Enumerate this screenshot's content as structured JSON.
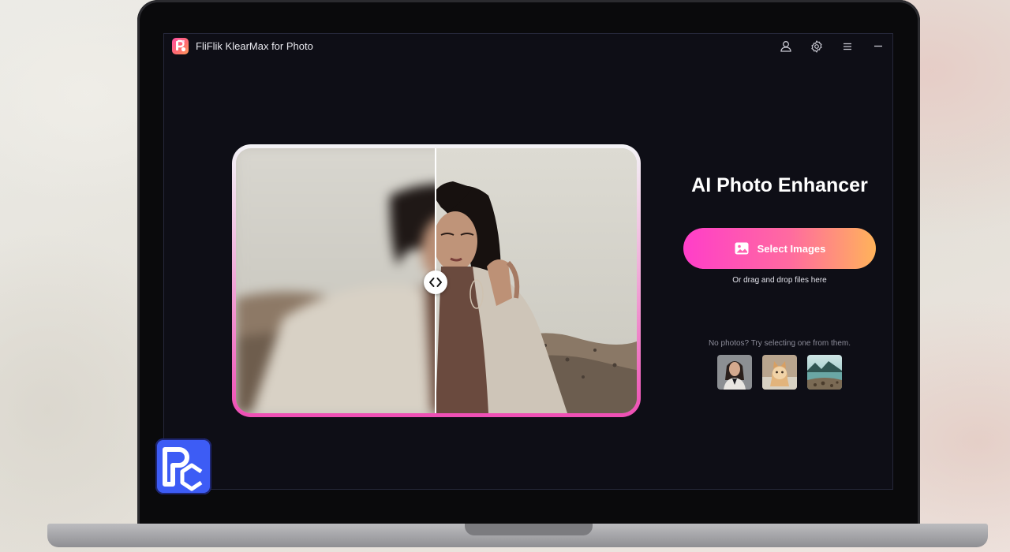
{
  "app": {
    "title": "FliFlik KlearMax for Photo",
    "logo_icon": "app-logo-icon"
  },
  "titlebar": {
    "icons": [
      "user-icon",
      "settings-icon",
      "menu-icon",
      "minimize-icon"
    ]
  },
  "comparison": {
    "left_state": "blurred original",
    "right_state": "enhanced",
    "handle_icon": "chevron-left-right-icon"
  },
  "main": {
    "headline": "AI Photo Enhancer",
    "select_button_label": "Select Images",
    "select_button_icon": "image-icon",
    "drag_hint": "Or drag and drop files here",
    "samples_hint": "No photos? Try selecting one from them.",
    "samples": [
      {
        "name": "sample-portrait"
      },
      {
        "name": "sample-cat"
      },
      {
        "name": "sample-landscape"
      }
    ]
  },
  "colors": {
    "app_background": "#0e0e16",
    "button_gradient_start": "#ff3ec9",
    "button_gradient_end": "#ffb35a",
    "frame_gradient_bottom": "#ee4fb4"
  }
}
